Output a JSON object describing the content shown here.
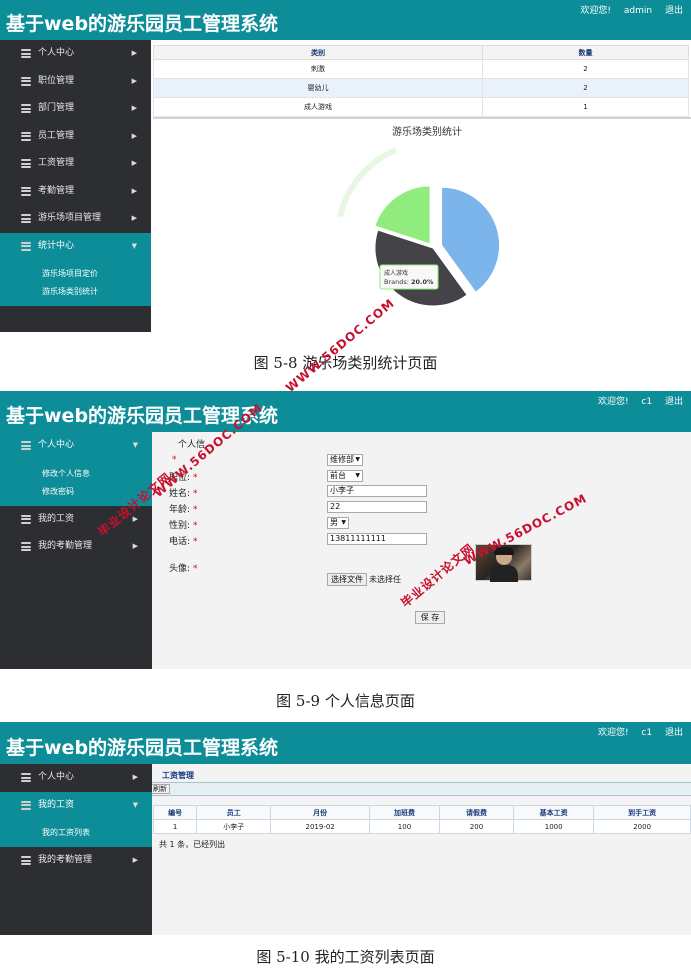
{
  "app_title": "基于web的游乐园员工管理系统",
  "panel1": {
    "topnav": [
      "欢迎您!",
      "admin",
      "退出"
    ],
    "menu": [
      {
        "label": "个人中心",
        "expanded": false
      },
      {
        "label": "职位管理",
        "expanded": false
      },
      {
        "label": "部门管理",
        "expanded": false
      },
      {
        "label": "员工管理",
        "expanded": false
      },
      {
        "label": "工资管理",
        "expanded": false
      },
      {
        "label": "考勤管理",
        "expanded": false
      },
      {
        "label": "游乐场项目管理",
        "expanded": false
      },
      {
        "label": "统计中心",
        "expanded": true
      }
    ],
    "submenu": [
      "游乐场项目定价",
      "游乐场类别统计"
    ],
    "table": {
      "headers": [
        "类别",
        "数量"
      ],
      "rows": [
        [
          "刺激",
          "2"
        ],
        [
          "婴幼儿",
          "2"
        ],
        [
          "成人游戏",
          "1"
        ]
      ]
    },
    "chart_data": {
      "type": "pie",
      "title": "游乐场类别统计",
      "slices": [
        {
          "label": "刺激",
          "value": 2,
          "color": "#7cb5ec"
        },
        {
          "label": "婴幼儿",
          "value": 2,
          "color": "#434348"
        },
        {
          "label": "成人游戏",
          "value": 1,
          "color": "#90ed7d"
        }
      ],
      "tooltip": {
        "category": "成人游戏",
        "series": "Brands",
        "value": "20.0%"
      }
    },
    "caption": "图 5-8 游乐场类别统计页面"
  },
  "panel2": {
    "topnav": [
      "欢迎您!",
      "c1",
      "退出"
    ],
    "menu": [
      {
        "label": "个人中心",
        "expanded": true
      },
      {
        "label": "我的工资",
        "expanded": false
      },
      {
        "label": "我的考勤管理",
        "expanded": false
      }
    ],
    "submenu": [
      "修改个人信息",
      "修改密码"
    ],
    "form": {
      "heading": "个人信",
      "fields": {
        "dept": {
          "label": "",
          "value": "维修部"
        },
        "position": {
          "label": "职位:",
          "value": "前台"
        },
        "name": {
          "label": "姓名:",
          "value": "小李子"
        },
        "age": {
          "label": "年龄:",
          "value": "22"
        },
        "gender": {
          "label": "性别:",
          "value": "男"
        },
        "phone": {
          "label": "电话:",
          "value": "13811111111"
        },
        "avatar": {
          "label": "头像:"
        }
      },
      "file_button": "选择文件",
      "file_status": "未选择任",
      "save_button": "保 存"
    },
    "caption": "图 5-9 个人信息页面"
  },
  "panel3": {
    "topnav": [
      "欢迎您!",
      "c1",
      "退出"
    ],
    "menu": [
      {
        "label": "个人中心",
        "expanded": false
      },
      {
        "label": "我的工资",
        "expanded": true
      },
      {
        "label": "我的考勤管理",
        "expanded": false
      }
    ],
    "submenu": [
      "我的工资列表"
    ],
    "section_title": "工资管理",
    "refresh_label": "刷新",
    "table": {
      "headers": [
        "编号",
        "员工",
        "月份",
        "加班费",
        "请假费",
        "基本工资",
        "到手工资"
      ],
      "rows": [
        [
          "1",
          "小李子",
          "2019-02",
          "100",
          "200",
          "1000",
          "2000"
        ]
      ]
    },
    "summary": "共 1 条，已经列出",
    "caption": "图 5-10 我的工资列表页面"
  },
  "watermarks": [
    "毕业设计论文网",
    "WWW.56DOC.COM"
  ],
  "colors": {
    "header": "#0d8d98",
    "sidebar": "#2d2e31",
    "watermark": "#c8102e"
  }
}
